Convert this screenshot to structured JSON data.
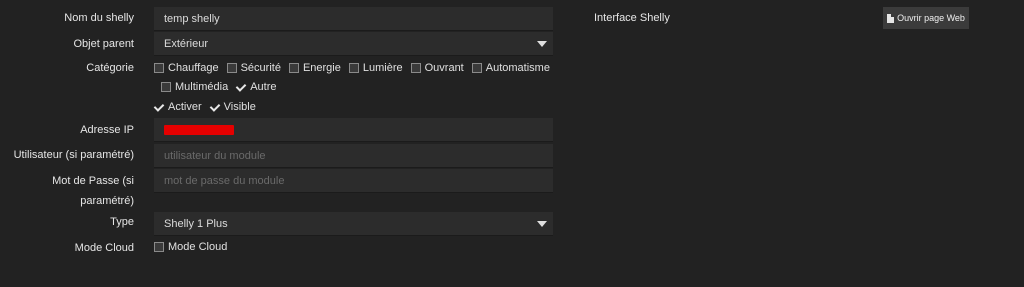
{
  "form": {
    "name_label": "Nom du shelly",
    "name_value": "temp shelly",
    "parent_label": "Objet parent",
    "parent_value": "Extérieur",
    "category_label": "Catégorie",
    "categories": [
      {
        "label": "Chauffage",
        "checked": false
      },
      {
        "label": "Sécurité",
        "checked": false
      },
      {
        "label": "Energie",
        "checked": false
      },
      {
        "label": "Lumière",
        "checked": false
      },
      {
        "label": "Ouvrant",
        "checked": false
      },
      {
        "label": "Automatisme",
        "checked": false
      },
      {
        "label": "Multimédia",
        "checked": false
      },
      {
        "label": "Autre",
        "checked": true
      }
    ],
    "activate_label": "Activer",
    "visible_label": "Visible",
    "ip_label": "Adresse IP",
    "user_label": "Utilisateur (si paramétré)",
    "user_placeholder": "utilisateur du module",
    "password_label_line1": "Mot de Passe (si",
    "password_label_line2": "paramétré)",
    "password_placeholder": "mot de passe du module",
    "type_label": "Type",
    "type_value": "Shelly 1 Plus",
    "cloud_label": "Mode Cloud",
    "cloud_checkbox_label": "Mode Cloud"
  },
  "right_panel": {
    "interface_label": "Interface Shelly",
    "open_web_button": "Ouvrir page Web"
  }
}
